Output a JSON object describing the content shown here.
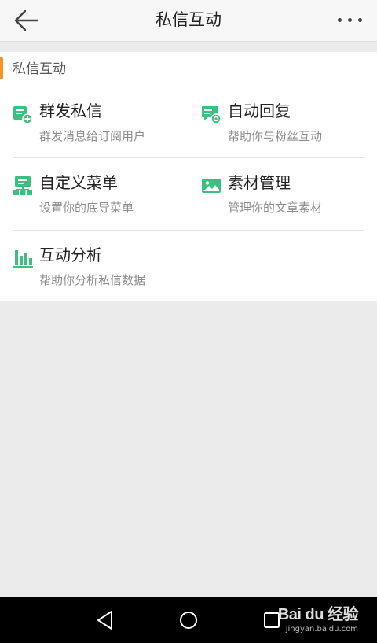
{
  "header": {
    "title": "私信互动"
  },
  "section": {
    "title": "私信互动",
    "accent_color": "#f7931e"
  },
  "features": [
    {
      "label": "群发私信",
      "desc": "群发消息给订阅用户",
      "icon": "broadcast-message-icon"
    },
    {
      "label": "自动回复",
      "desc": "帮助你与粉丝互动",
      "icon": "auto-reply-icon"
    },
    {
      "label": "自定义菜单",
      "desc": "设置你的底导菜单",
      "icon": "custom-menu-icon"
    },
    {
      "label": "素材管理",
      "desc": "管理你的文章素材",
      "icon": "material-icon"
    },
    {
      "label": "互动分析",
      "desc": "帮助你分析私信数据",
      "icon": "analytics-icon"
    }
  ],
  "theme": {
    "icon_color": "#3dbf7f",
    "background": "#ebebeb"
  },
  "watermark": {
    "brand": "Bai du 经验",
    "url": "jingyan.baidu.com"
  }
}
